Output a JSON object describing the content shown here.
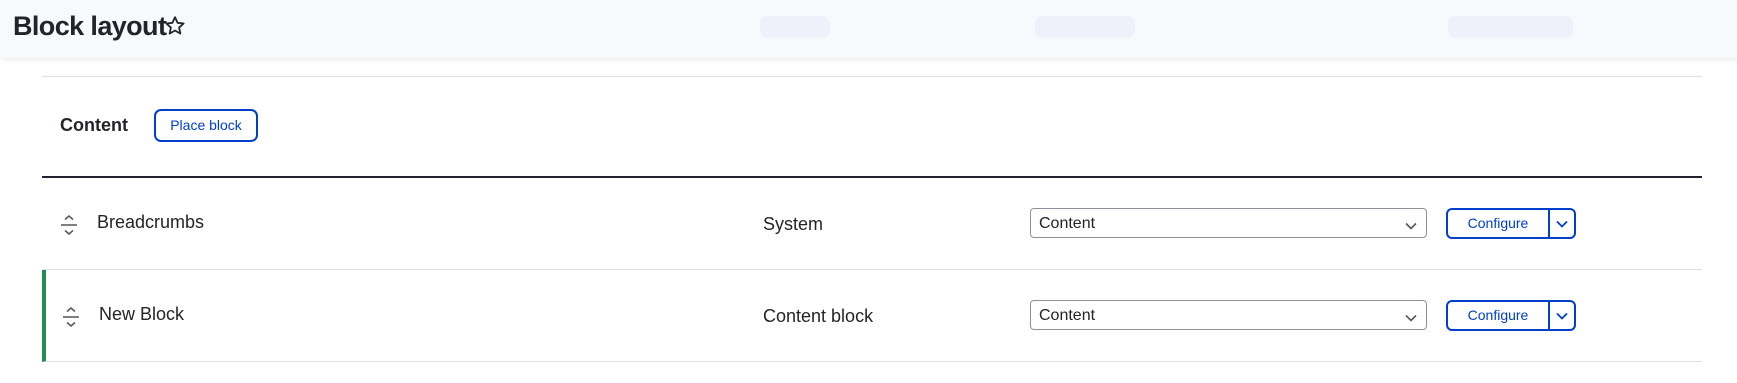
{
  "header": {
    "title": "Block layout",
    "favorite_icon": "star-outline-icon"
  },
  "region": {
    "title": "Content",
    "place_block_label": "Place block"
  },
  "blocks": [
    {
      "name": "Breadcrumbs",
      "category": "System",
      "region_value": "Content",
      "configure_label": "Configure",
      "highlighted": false
    },
    {
      "name": "New Block",
      "category": "Content block",
      "region_value": "Content",
      "configure_label": "Configure",
      "highlighted": true
    }
  ],
  "colors": {
    "accent": "#003ecc",
    "highlight_bar": "#228a52",
    "header_bg": "#f8f9fd",
    "divider": "#dedfe4",
    "text": "#232429"
  }
}
